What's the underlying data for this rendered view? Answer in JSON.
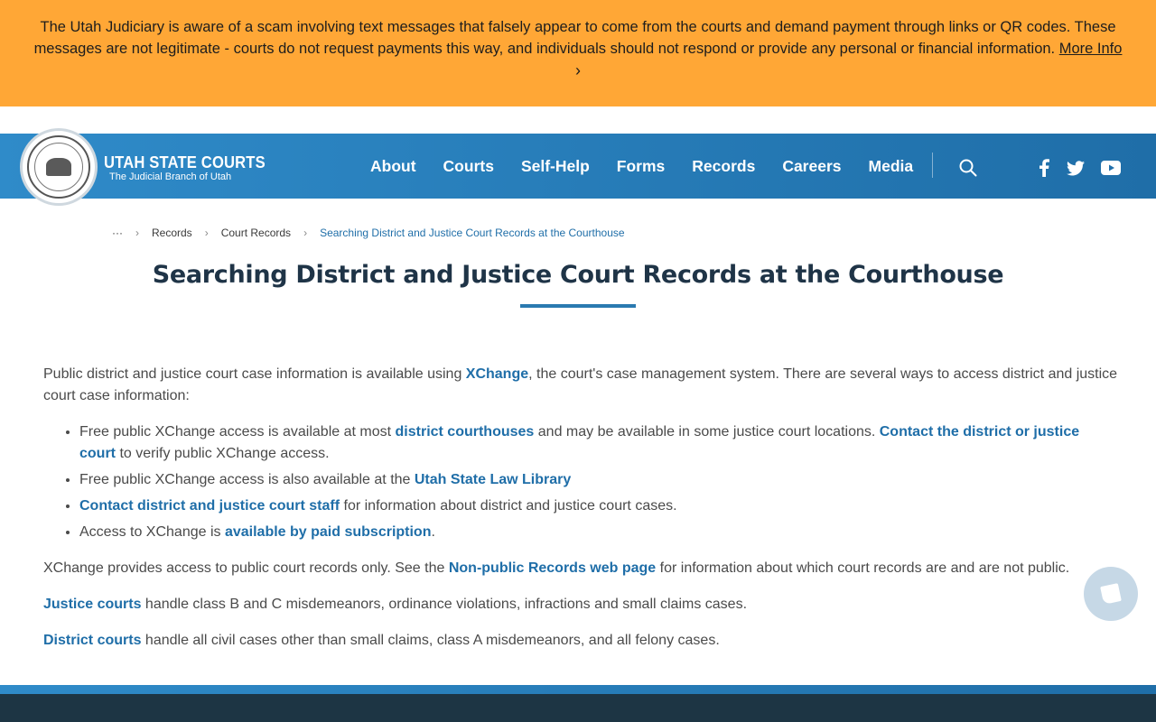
{
  "alert": {
    "message": "The Utah Judiciary is aware of a scam involving text messages that falsely appear to come from the courts and demand payment through links or QR codes. These messages are not legitimate - courts do not request payments this way, and individuals should not respond or provide any personal or financial information.",
    "link": "More Info",
    "chevron": "›"
  },
  "header": {
    "title": "UTAH STATE COURTS",
    "subtitle": "The Judicial Branch of Utah",
    "nav": [
      "About",
      "Courts",
      "Self-Help",
      "Forms",
      "Records",
      "Careers",
      "Media"
    ]
  },
  "breadcrumb": {
    "ellipsis": "···",
    "items": [
      "Records",
      "Court Records"
    ],
    "current": "Searching District and Justice Court Records at the Courthouse",
    "separator": "›"
  },
  "page": {
    "title": "Searching District and Justice Court Records at the Courthouse"
  },
  "content": {
    "intro": {
      "pre": "Public district and justice court case information is available using ",
      "link": "XChange",
      "post": ", the court's case management system. There are several ways to access district and justice court case information:"
    },
    "bullets": [
      {
        "pre": "Free public XChange access is available at most ",
        "link1": "district courthouses",
        "mid": " and may be available in some justice court locations. ",
        "link2": "Contact the district or justice court",
        "post": " to verify public XChange access."
      },
      {
        "pre": "Free public XChange access is also available at the ",
        "link": "Utah State Law Library"
      },
      {
        "link": "Contact district and justice court staff",
        "post": " for information about district and justice court cases."
      },
      {
        "pre": "Access to XChange is ",
        "link": "available by paid subscription",
        "post": "."
      }
    ],
    "nonpublic": {
      "pre": "XChange provides access to public court records only. See the ",
      "link": "Non-public Records web page",
      "post": " for information about which court records are and are not public."
    },
    "justice": {
      "link": "Justice courts",
      "post": " handle class B and C misdemeanors, ordinance violations, infractions and small claims cases."
    },
    "district": {
      "link": "District courts",
      "post": " handle all civil cases other than small claims, class A misdemeanors, and all felony cases."
    }
  },
  "icons": {
    "search": "search-icon",
    "facebook": "facebook-icon",
    "twitter": "twitter-icon",
    "youtube": "youtube-icon",
    "chat": "chat-icon"
  },
  "colors": {
    "alert_bg": "#ffa736",
    "header_blue": "#2a7ab0",
    "link": "#1f6ea8",
    "title": "#1f3447",
    "footer": "#1d3544"
  }
}
